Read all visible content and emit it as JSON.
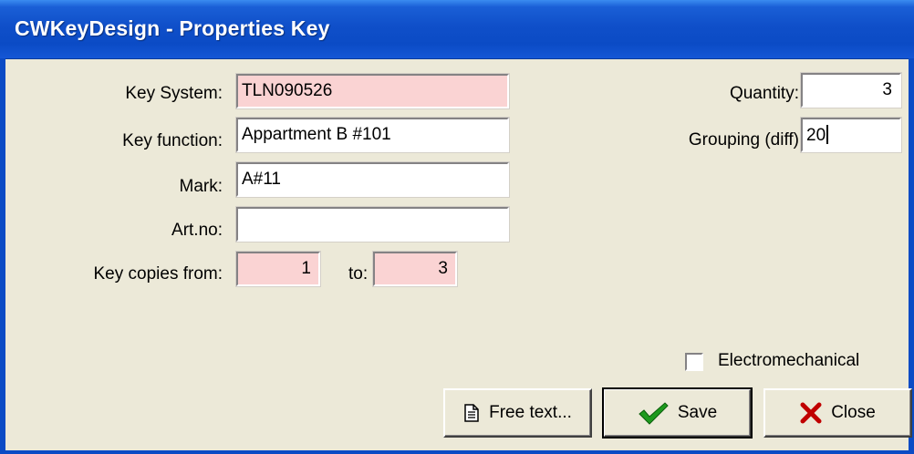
{
  "window": {
    "title": "CWKeyDesign - Properties Key"
  },
  "form": {
    "key_system": {
      "label": "Key System:",
      "value": "TLN090526"
    },
    "key_function": {
      "label": "Key function:",
      "value": "Appartment B #101"
    },
    "mark": {
      "label": "Mark:",
      "value": "A#11"
    },
    "art_no": {
      "label": "Art.no:",
      "value": ""
    },
    "key_copies": {
      "label": "Key copies from:",
      "from": "1",
      "to_label": "to:",
      "to": "3"
    },
    "quantity": {
      "label": "Quantity:",
      "value": "3"
    },
    "grouping": {
      "label": "Grouping (diff)",
      "value": "20"
    },
    "electromechanical": {
      "label": "Electromechanical",
      "checked": false
    }
  },
  "buttons": {
    "free_text": {
      "label": "Free text...",
      "icon": "document-icon"
    },
    "save": {
      "label": "Save",
      "icon": "checkmark-icon"
    },
    "close": {
      "label": "Close",
      "icon": "close-x-icon"
    }
  },
  "colors": {
    "title_bar": "#0b4bc5",
    "dialog_bg": "#ece9d8",
    "readonly_field_bg": "#fad3d3",
    "save_check": "#1e9a1e",
    "close_x": "#c00000"
  }
}
